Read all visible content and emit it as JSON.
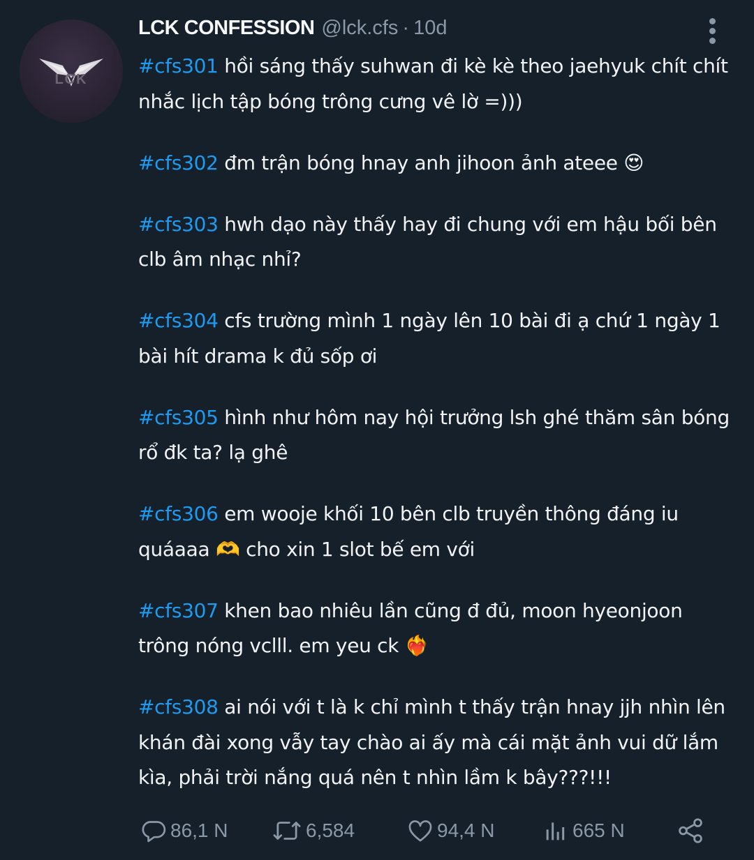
{
  "tweet": {
    "display_name": "LCK CONFESSION",
    "handle": "@lck.cfs",
    "separator": "·",
    "time": "10d",
    "avatar_logo_text": "LCK",
    "paragraphs": [
      {
        "tag": "#cfs301",
        "text": " hồi sáng thấy suhwan đi kè kè theo jaehyuk chít chít nhắc lịch tập bóng trông cưng vê lờ  =)))"
      },
      {
        "tag": "#cfs302",
        "text": " đm trận bóng hnay anh jihoon ảnh ateee 😍"
      },
      {
        "tag": "#cfs303",
        "text": " hwh dạo này thấy hay đi chung với em hậu bối bên clb âm nhạc nhỉ?"
      },
      {
        "tag": "#cfs304",
        "text": " cfs trường mình 1 ngày lên 10 bài đi ạ chứ 1 ngày 1 bài hít drama k đủ sốp ơi"
      },
      {
        "tag": "#cfs305",
        "text": " hình như hôm nay hội trưởng lsh ghé thăm sân bóng rổ đk ta? lạ ghê"
      },
      {
        "tag": "#cfs306",
        "text": " em wooje khối 10 bên clb truyền thông đáng iu quáaaa 🫶 cho xin 1 slot bế em với"
      },
      {
        "tag": "#cfs307",
        "text": " khen bao nhiêu lần cũng đ đủ, moon hyeonjoon trông nóng vclll. em yeu ck ❤️‍🔥"
      },
      {
        "tag": "#cfs308",
        "text": " ai nói với t là k chỉ mình t thấy trận hnay jjh nhìn lên khán đài xong vẫy tay chào ai ấy mà cái mặt ảnh vui dữ lắm kìa, phải trời nắng quá nên t nhìn lầm k bây???!!!"
      }
    ]
  },
  "actions": {
    "reply": {
      "icon": "reply-icon",
      "count": "86,1 N"
    },
    "retweet": {
      "icon": "retweet-icon",
      "count": "6,584"
    },
    "like": {
      "icon": "heart-icon",
      "count": "94,4 N"
    },
    "views": {
      "icon": "views-chart-icon",
      "count": "665 N"
    },
    "share": {
      "icon": "share-icon"
    }
  },
  "colors": {
    "background": "#15202b",
    "text": "#f2f3f4",
    "muted": "#8b98a5",
    "hashtag": "#1d9bf0"
  }
}
